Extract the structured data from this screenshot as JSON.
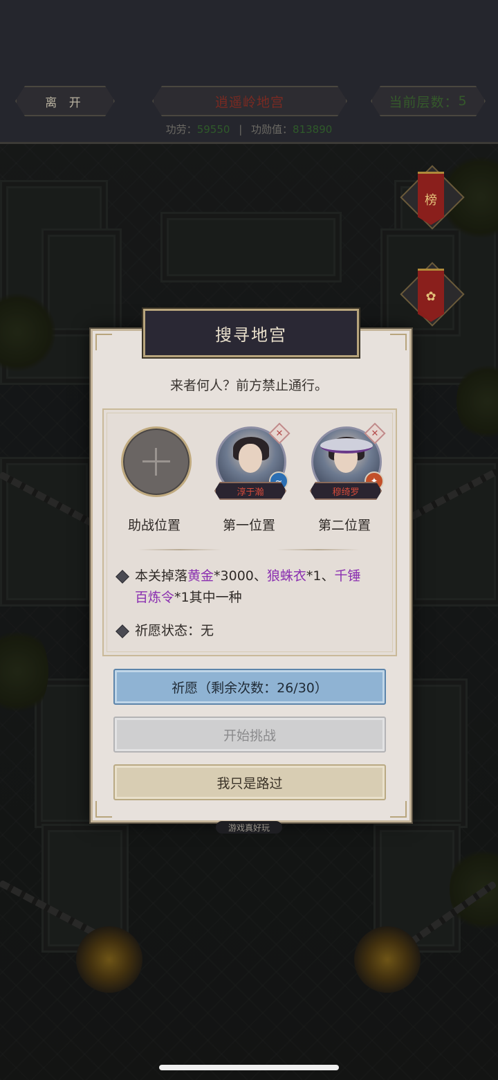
{
  "header": {
    "leave_label": "离 开",
    "dungeon_name": "逍遥岭地宫",
    "floor_label": "当前层数：",
    "floor_value": "5",
    "merit_label": "功劳：",
    "merit_value": "59550",
    "merit_sep": "|",
    "honor_label": "功勋值：",
    "honor_value": "813890"
  },
  "side": {
    "ranking_label": "榜"
  },
  "dialog": {
    "title": "搜寻地宫",
    "intro": "来者何人？前方禁止通行。",
    "slots": [
      {
        "label": "助战位置",
        "type": "empty"
      },
      {
        "label": "第一位置",
        "type": "hero",
        "name": "淳于瀚"
      },
      {
        "label": "第二位置",
        "type": "hero",
        "name": "穆绮罗"
      }
    ],
    "drop": {
      "prefix": "本关掉落",
      "item1": "黄金",
      "qty1": "*3000",
      "sep1": "、",
      "item2": "狼蛛衣",
      "qty2": "*1",
      "sep2": "、",
      "item3a": "千锤",
      "item3b": "百炼令",
      "qty3": "*1",
      "suffix": "其中一种"
    },
    "wish_status_label": "祈愿状态：",
    "wish_status_value": "无",
    "buttons": {
      "wish": "祈愿（剩余次数：26/30）",
      "start": "开始挑战",
      "pass": "我只是路过"
    },
    "tip": "游戏真好玩"
  },
  "colors": {
    "accent_purple": "#8a2fb0",
    "wish_button": "#8fb3d3",
    "name_red": "#d24a3a"
  }
}
